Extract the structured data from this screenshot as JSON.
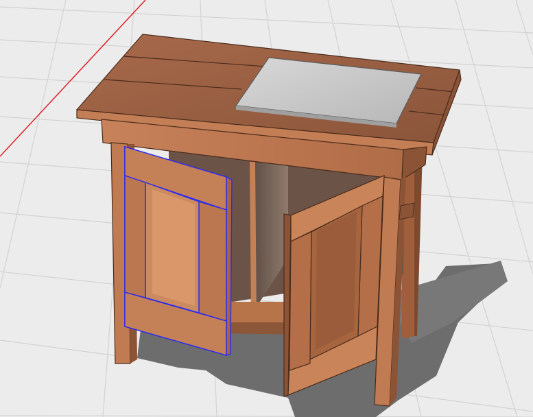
{
  "viewport": {
    "background_color": "#ececec",
    "grid_color": "#d2d2d2",
    "axis_color": "#e0141e",
    "shadow_color": "#6d6d6d"
  },
  "model": {
    "object": "side-table-cabinet",
    "materials": {
      "wood_light": "#c07a52",
      "wood_mid": "#a9643f",
      "wood_dark": "#7d4a30",
      "metal_top": "#c9c9c9"
    },
    "selection": {
      "selected_part": "left-cabinet-door",
      "highlight_color": "#2a2af0"
    },
    "doors": {
      "left": "selected",
      "right": "open"
    }
  },
  "status": {
    "text": ""
  }
}
